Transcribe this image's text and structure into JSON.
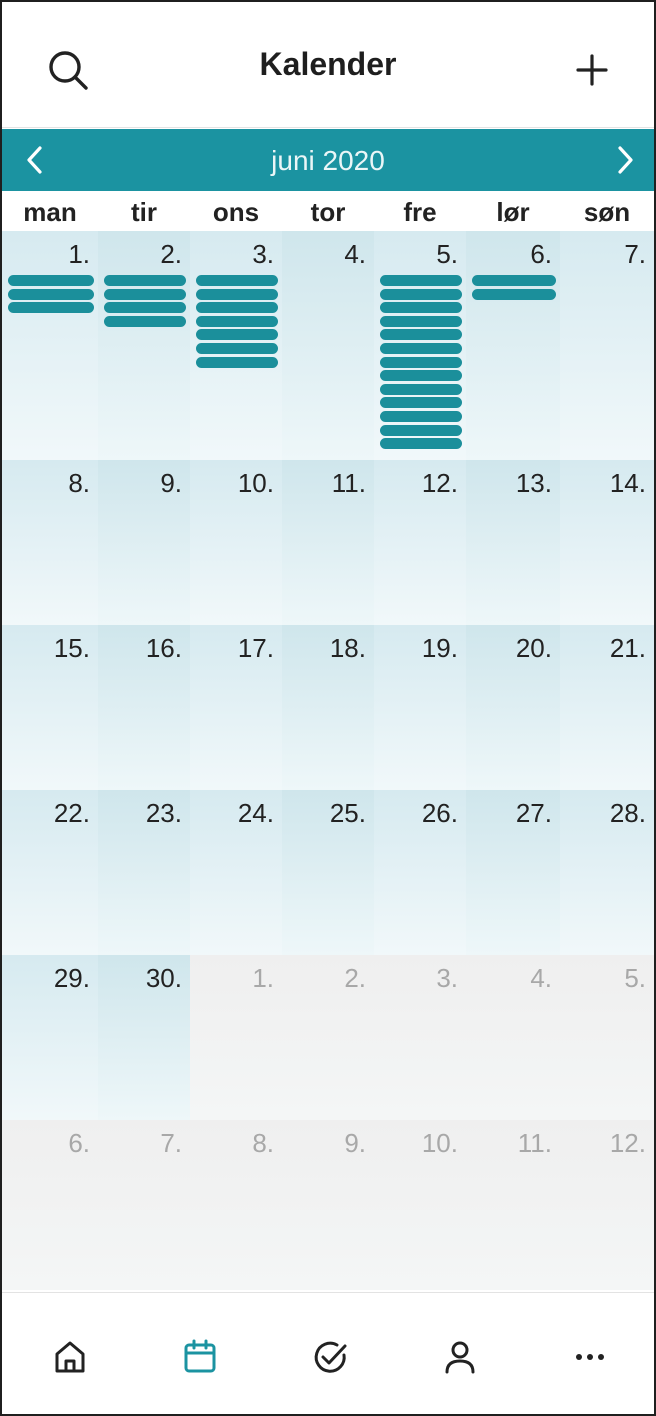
{
  "header": {
    "title": "Kalender",
    "search_icon": "search-icon",
    "add_icon": "plus-icon"
  },
  "month_nav": {
    "label": "juni 2020",
    "prev_icon": "chevron-left-icon",
    "next_icon": "chevron-right-icon"
  },
  "weekdays": [
    "man",
    "tir",
    "ons",
    "tor",
    "fre",
    "lør",
    "søn"
  ],
  "weeks": [
    [
      {
        "day": "1.",
        "month": "current",
        "events": 3
      },
      {
        "day": "2.",
        "month": "current",
        "events": 4
      },
      {
        "day": "3.",
        "month": "current",
        "events": 7
      },
      {
        "day": "4.",
        "month": "current",
        "events": 0
      },
      {
        "day": "5.",
        "month": "current",
        "events": 13
      },
      {
        "day": "6.",
        "month": "current",
        "events": 2,
        "selected": true
      },
      {
        "day": "7.",
        "month": "current",
        "events": 0
      }
    ],
    [
      {
        "day": "8.",
        "month": "current",
        "events": 0
      },
      {
        "day": "9.",
        "month": "current",
        "events": 0
      },
      {
        "day": "10.",
        "month": "current",
        "events": 0
      },
      {
        "day": "11.",
        "month": "current",
        "events": 0
      },
      {
        "day": "12.",
        "month": "current",
        "events": 0
      },
      {
        "day": "13.",
        "month": "current",
        "events": 0
      },
      {
        "day": "14.",
        "month": "current",
        "events": 0
      }
    ],
    [
      {
        "day": "15.",
        "month": "current",
        "events": 0
      },
      {
        "day": "16.",
        "month": "current",
        "events": 0
      },
      {
        "day": "17.",
        "month": "current",
        "events": 0
      },
      {
        "day": "18.",
        "month": "current",
        "events": 0
      },
      {
        "day": "19.",
        "month": "current",
        "events": 0
      },
      {
        "day": "20.",
        "month": "current",
        "events": 0
      },
      {
        "day": "21.",
        "month": "current",
        "events": 0
      }
    ],
    [
      {
        "day": "22.",
        "month": "current",
        "events": 0
      },
      {
        "day": "23.",
        "month": "current",
        "events": 0
      },
      {
        "day": "24.",
        "month": "current",
        "events": 0
      },
      {
        "day": "25.",
        "month": "current",
        "events": 0
      },
      {
        "day": "26.",
        "month": "current",
        "events": 0
      },
      {
        "day": "27.",
        "month": "current",
        "events": 0
      },
      {
        "day": "28.",
        "month": "current",
        "events": 0
      }
    ],
    [
      {
        "day": "29.",
        "month": "current",
        "events": 0
      },
      {
        "day": "30.",
        "month": "current",
        "events": 0
      },
      {
        "day": "1.",
        "month": "next",
        "events": 0
      },
      {
        "day": "2.",
        "month": "next",
        "events": 0
      },
      {
        "day": "3.",
        "month": "next",
        "events": 0
      },
      {
        "day": "4.",
        "month": "next",
        "events": 0
      },
      {
        "day": "5.",
        "month": "next",
        "events": 0
      }
    ],
    [
      {
        "day": "6.",
        "month": "next",
        "events": 0
      },
      {
        "day": "7.",
        "month": "next",
        "events": 0
      },
      {
        "day": "8.",
        "month": "next",
        "events": 0
      },
      {
        "day": "9.",
        "month": "next",
        "events": 0
      },
      {
        "day": "10.",
        "month": "next",
        "events": 0
      },
      {
        "day": "11.",
        "month": "next",
        "events": 0
      },
      {
        "day": "12.",
        "month": "next",
        "events": 0
      }
    ]
  ],
  "tabbar": {
    "items": [
      {
        "icon": "home-icon",
        "active": false
      },
      {
        "icon": "calendar-icon",
        "active": true
      },
      {
        "icon": "check-circle-icon",
        "active": false
      },
      {
        "icon": "user-icon",
        "active": false
      },
      {
        "icon": "more-dots-icon",
        "active": false
      }
    ]
  },
  "colors": {
    "accent": "#1b93a1",
    "event": "#1b8f9b",
    "icon": "#222222"
  }
}
